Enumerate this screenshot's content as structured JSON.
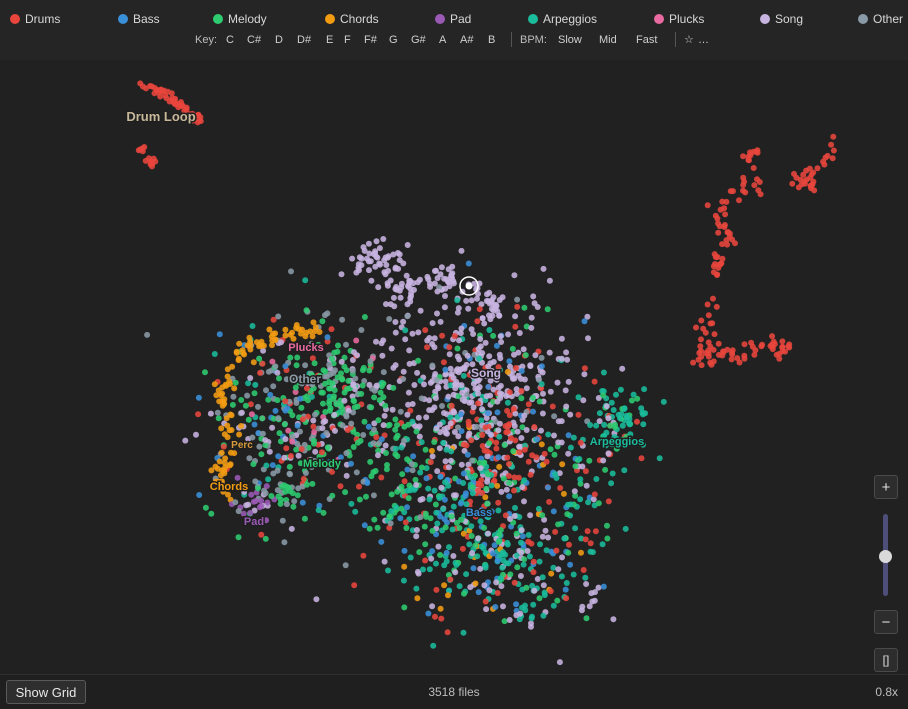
{
  "legend": [
    {
      "label": "Drums",
      "color": "#e8453c"
    },
    {
      "label": "Bass",
      "color": "#3a8fd9"
    },
    {
      "label": "Melody",
      "color": "#2ecc71"
    },
    {
      "label": "Chords",
      "color": "#f39c12"
    },
    {
      "label": "Pad",
      "color": "#9b59b6"
    },
    {
      "label": "Arpeggios",
      "color": "#1abc9c"
    },
    {
      "label": "Plucks",
      "color": "#e96aa0"
    },
    {
      "label": "Song",
      "color": "#c7b3e0"
    },
    {
      "label": "Other",
      "color": "#8a9aa6"
    }
  ],
  "filters": {
    "key_label": "Key:",
    "keys": [
      "C",
      "C#",
      "D",
      "D#",
      "E",
      "F",
      "F#",
      "G",
      "G#",
      "A",
      "A#",
      "B"
    ],
    "bpm_label": "BPM:",
    "bpm_options": [
      "Slow",
      "Mid",
      "Fast"
    ],
    "favorites_glyph": "☆",
    "more_glyph": "…"
  },
  "map": {
    "cluster_labels": [
      {
        "text": "Drum Loop",
        "color": "#c8b89a"
      },
      {
        "text": "Plucks",
        "color": "#e96aa0"
      },
      {
        "text": "Other",
        "color": "#8a9aa6"
      },
      {
        "text": "Song",
        "color": "#c7b3e0"
      },
      {
        "text": "Arpeggios",
        "color": "#1abc9c"
      },
      {
        "text": "Perc",
        "color": "#d89a3a"
      },
      {
        "text": "Melody",
        "color": "#2ecc71"
      },
      {
        "text": "Chords",
        "color": "#f39c12"
      },
      {
        "text": "Bass",
        "color": "#3a8fd9"
      },
      {
        "text": "Pad",
        "color": "#9b59b6"
      }
    ]
  },
  "zoom": {
    "plus": "+",
    "minus": "−",
    "fit": "[]",
    "level": "0.8x"
  },
  "footer": {
    "show_grid": "Show Grid",
    "file_count": "3518 files"
  }
}
